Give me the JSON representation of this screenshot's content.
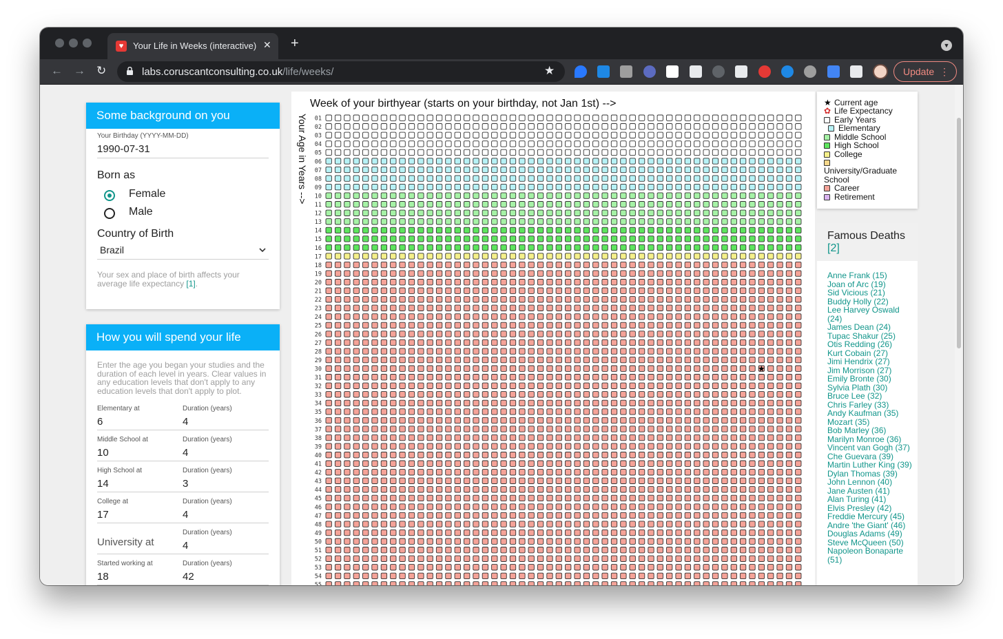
{
  "browser": {
    "tab_title": "Your Life in Weeks (interactive)",
    "tab_close": "✕",
    "new_tab": "+",
    "url_host": "labs.coruscantconsulting.co.uk",
    "url_path": "/life/weeks/",
    "update_label": "Update",
    "update_menu": "⋮",
    "back": "←",
    "forward": "→",
    "reload": "↻",
    "star": "★"
  },
  "background_card": {
    "title": "Some background on you",
    "birthday_label": "Your Birthday (YYYY-MM-DD)",
    "birthday_value": "1990-07-31",
    "born_as_label": "Born as",
    "female_label": "Female",
    "male_label": "Male",
    "selected_sex": "Female",
    "country_label": "Country of Birth",
    "country_value": "Brazil",
    "hint_text": "Your sex and place of birth affects your average life expectancy",
    "hint_ref": "[1]",
    "hint_end": "."
  },
  "life_card": {
    "title": "How you will spend your life",
    "intro": "Enter the age you began your studies and the duration of each level in years. Clear values in any education levels that don't apply to any education levels that don't apply to plot.",
    "rows": [
      {
        "label": "Elementary at",
        "value": "6",
        "duration_label": "Duration (years)",
        "duration": "4"
      },
      {
        "label": "Middle School at",
        "value": "10",
        "duration_label": "Duration (years)",
        "duration": "4"
      },
      {
        "label": "High School at",
        "value": "14",
        "duration_label": "Duration (years)",
        "duration": "3"
      },
      {
        "label": "College at",
        "value": "17",
        "duration_label": "Duration (years)",
        "duration": "4"
      },
      {
        "label": "",
        "value": "University at",
        "duration_label": "Duration (years)",
        "duration": "4"
      },
      {
        "label": "Started working at",
        "value": "18",
        "duration_label": "Duration (years)",
        "duration": "42"
      }
    ]
  },
  "grid": {
    "title": "Week of your birthyear (starts on your birthday, not Jan 1st) -->",
    "age_axis_label": "Your Age in Years -->",
    "weeks_per_year": 52,
    "visible_years": 55,
    "current_age": {
      "year": 30,
      "week": 48
    },
    "stages": [
      {
        "name": "Early Years",
        "from_age": 1,
        "to_age": 5,
        "fill": "#ffffff"
      },
      {
        "name": "Elementary",
        "from_age": 6,
        "to_age": 9,
        "fill": "#b7f2f6"
      },
      {
        "name": "Middle School",
        "from_age": 10,
        "to_age": 13,
        "fill": "#a6f2a6"
      },
      {
        "name": "High School",
        "from_age": 14,
        "to_age": 16,
        "fill": "#5ee55e"
      },
      {
        "name": "College",
        "from_age": 17,
        "to_age": 17,
        "fill": "#f5f08a"
      },
      {
        "name": "Career",
        "from_age": 18,
        "to_age": 60,
        "fill": "#f5a398"
      }
    ]
  },
  "legend": {
    "items": [
      {
        "name": "Current age",
        "kind": "star-icon",
        "color": "#000000"
      },
      {
        "name": "Life Expectancy",
        "kind": "flower-icon",
        "color": "#d32f2f"
      },
      {
        "name": "Early Years",
        "kind": "swatch",
        "color": "#ffffff"
      },
      {
        "name": "Elementary",
        "kind": "swatch",
        "color": "#b7f2f6"
      },
      {
        "name": "Middle School",
        "kind": "swatch",
        "color": "#a6f2a6"
      },
      {
        "name": "High School",
        "kind": "swatch",
        "color": "#5ee55e"
      },
      {
        "name": "College",
        "kind": "swatch",
        "color": "#f5f08a"
      },
      {
        "name": "University/Graduate School",
        "kind": "swatch",
        "color": "#f5d78a"
      },
      {
        "name": "Career",
        "kind": "swatch",
        "color": "#f5a398"
      },
      {
        "name": "Retirement",
        "kind": "swatch",
        "color": "#d9b3f0"
      }
    ]
  },
  "famous_deaths": {
    "title": "Famous Deaths",
    "ref": "[2]",
    "people": [
      "Anne Frank (15)",
      "Joan of Arc (19)",
      "Sid Vicious (21)",
      "Buddy Holly (22)",
      "Lee Harvey Oswald (24)",
      "James Dean (24)",
      "Tupac Shakur (25)",
      "Otis Redding (26)",
      "Kurt Cobain (27)",
      "Jimi Hendrix (27)",
      "Jim Morrison (27)",
      "Emily Bronte (30)",
      "Sylvia Plath (30)",
      "Bruce Lee (32)",
      "Chris Farley (33)",
      "Andy Kaufman (35)",
      "Mozart (35)",
      "Bob Marley (36)",
      "Marilyn Monroe (36)",
      "Vincent van Gogh (37)",
      "Che Guevara (39)",
      "Martin Luther King (39)",
      "Dylan Thomas (39)",
      "John Lennon (40)",
      "Jane Austen (41)",
      "Alan Turing (41)",
      "Elvis Presley (42)",
      "Freddie Mercury (45)",
      "Andre 'the Giant' (46)",
      "Douglas Adams (49)",
      "Steve McQueen (50)",
      "Napoleon Bonaparte (51)"
    ]
  }
}
